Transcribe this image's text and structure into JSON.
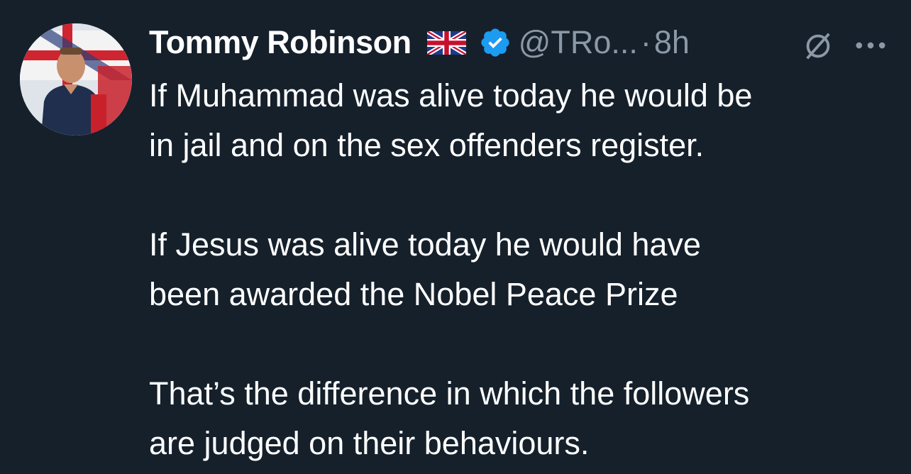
{
  "tweet": {
    "author": {
      "display_name": "Tommy Robinson",
      "flag_emoji": "union-jack-flag-icon",
      "verified_badge": "verified-badge-icon",
      "handle": "@TRo...",
      "separator": "·",
      "timestamp": "8h"
    },
    "actions": {
      "grok_icon": "grok-icon",
      "more_icon": "more-options-icon"
    },
    "paragraphs": [
      "If Muhammad was alive today he would be\nin jail and on the sex offenders register.",
      "If Jesus was alive today he would have\nbeen awarded the Nobel Peace Prize",
      "That’s the difference in which the followers\nare judged on their behaviours."
    ]
  },
  "colors": {
    "background": "#15202b",
    "text_primary": "#ffffff",
    "text_secondary": "#8b98a5",
    "verified_blue": "#1d9bf0"
  }
}
